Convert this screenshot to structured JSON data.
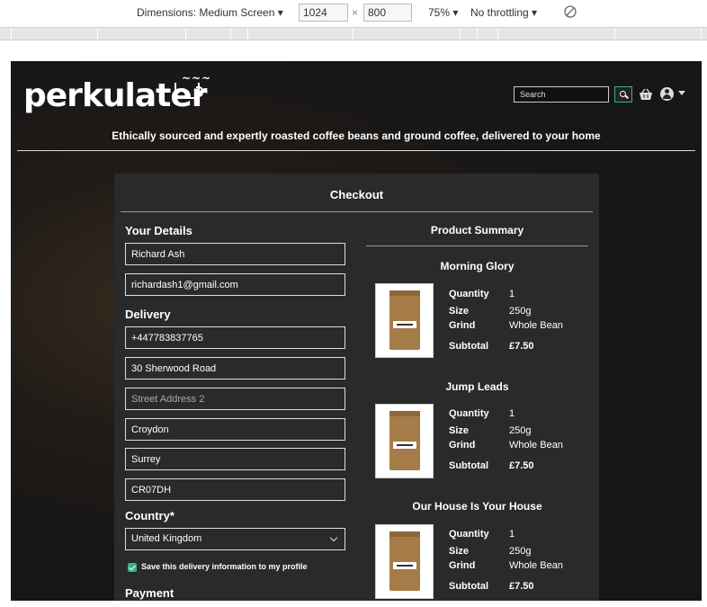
{
  "devtools": {
    "dimensions_label": "Dimensions: Medium Screen",
    "width": "1024",
    "times": "×",
    "height": "800",
    "zoom": "75%",
    "throttling": "No throttling"
  },
  "header": {
    "logo_text": "perkulater",
    "search_placeholder": "Search",
    "tagline": "Ethically sourced and expertly roasted coffee beans and ground coffee, delivered to your home"
  },
  "checkout": {
    "title": "Checkout",
    "your_details_heading": "Your Details",
    "full_name": "Richard Ash",
    "email": "richardash1@gmail.com",
    "delivery_heading": "Delivery",
    "phone": "+447783837765",
    "street1": "30 Sherwood Road",
    "street2_placeholder": "Street Address 2",
    "town": "Croydon",
    "county": "Surrey",
    "postcode": "CR07DH",
    "country_label": "Country*",
    "country_value": "United Kingdom",
    "save_info_label": "Save this delivery information to my profile",
    "payment_heading": "Payment"
  },
  "summary": {
    "title": "Product Summary",
    "labels": {
      "quantity": "Quantity",
      "size": "Size",
      "grind": "Grind",
      "subtotal": "Subtotal"
    },
    "products": [
      {
        "name": "Morning Glory",
        "quantity": "1",
        "size": "250g",
        "grind": "Whole Bean",
        "subtotal": "£7.50"
      },
      {
        "name": "Jump Leads",
        "quantity": "1",
        "size": "250g",
        "grind": "Whole Bean",
        "subtotal": "£7.50"
      },
      {
        "name": "Our House Is Your House",
        "quantity": "1",
        "size": "250g",
        "grind": "Whole Bean",
        "subtotal": "£7.50"
      }
    ]
  },
  "colors": {
    "accent": "#3ab08a",
    "panel": "#2a2a2a",
    "page_background": "#1b1b1b"
  }
}
